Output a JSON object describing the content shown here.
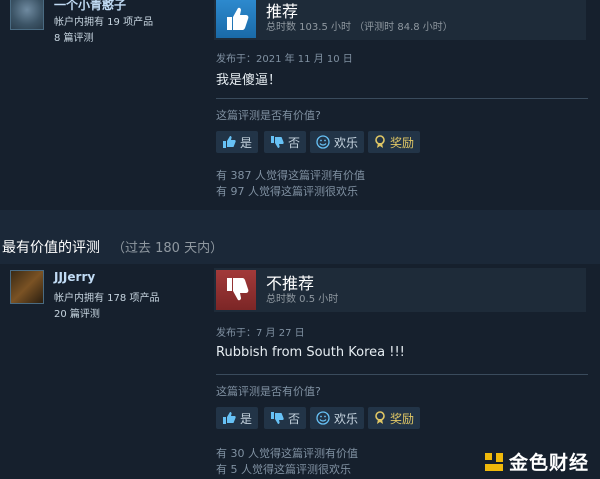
{
  "reviews": [
    {
      "author": "一个小青憨子",
      "products": "帐户内拥有 19 项产品",
      "review_count": "8 篇评测",
      "verdict": "推荐",
      "hours": "总时数 103.5 小时  （评测时 84.8 小时）",
      "posted": "发布于：2021 年 11 月 10 日",
      "content": "我是傻逼！",
      "helpful_question": "这篇评测是否有价值?",
      "buttons": {
        "yes": "是",
        "no": "否",
        "funny": "欢乐",
        "award": "奖励"
      },
      "helpful_count": "有 387 人觉得这篇评测有价值",
      "funny_count": "有 97 人觉得这篇评测很欢乐"
    },
    {
      "author": "JJJerry",
      "products": "帐户内拥有 178 项产品",
      "review_count": "20 篇评测",
      "verdict": "不推荐",
      "hours": "总时数 0.5 小时",
      "posted": "发布于：7 月 27 日",
      "content": "Rubbish from South Korea !!!",
      "helpful_question": "这篇评测是否有价值?",
      "buttons": {
        "yes": "是",
        "no": "否",
        "funny": "欢乐",
        "award": "奖励"
      },
      "helpful_count": "有 30 人觉得这篇评测有价值",
      "funny_count": "有 5 人觉得这篇评测很欢乐"
    }
  ],
  "section": {
    "title": "最有价值的评测",
    "subtitle": "（过去 180 天内）"
  },
  "watermark": {
    "text": "金色财经"
  },
  "colors": {
    "background": "#1b2838",
    "recommend": "#1a6aa8",
    "not_recommend": "#a23a3a",
    "award": "#e0c765"
  }
}
